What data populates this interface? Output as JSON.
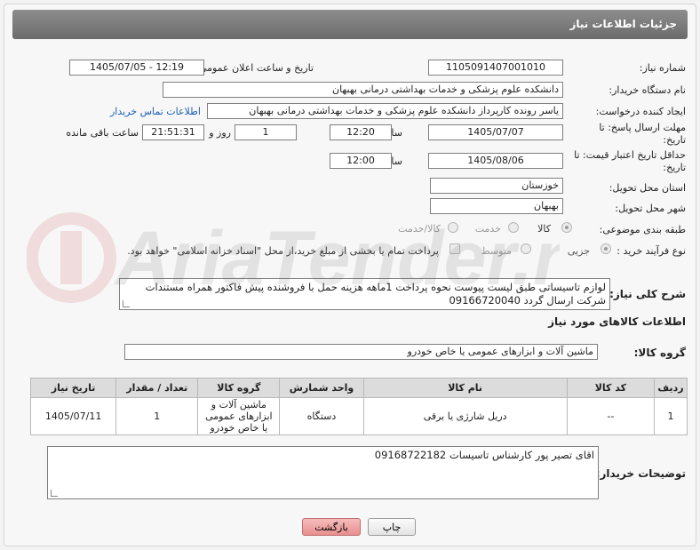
{
  "page": {
    "title": "جزئیات اطلاعات نیاز"
  },
  "form": {
    "need_number": {
      "label": "شماره نیاز:",
      "value": "1105091407001010"
    },
    "announce_datetime": {
      "label": "تاریخ و ساعت اعلان عمومی:",
      "value": "1405/07/05 - 12:19"
    },
    "buyer_org": {
      "label": "نام دستگاه خریدار:",
      "value": "دانشکده علوم پزشکی و خدمات بهداشتی  درمانی بهبهان"
    },
    "requester": {
      "label": "ایجاد کننده درخواست:",
      "value": "یاسر رونده کارپرداز دانشکده علوم پزشکی و خدمات بهداشتی  درمانی بهبهان",
      "contact_link": "اطلاعات تماس خریدار"
    },
    "reply_deadline": {
      "label": "مهلت ارسال پاسخ: تا تاریخ:",
      "date": "1405/07/07",
      "time_label": "ساعت",
      "time": "12:20",
      "days": "1",
      "days_label": "روز و",
      "remaining": "21:51:31",
      "remaining_label": "ساعت باقی مانده"
    },
    "price_validity": {
      "label": "حداقل تاریخ اعتبار قیمت: تا تاریخ:",
      "date": "1405/08/06",
      "time_label": "ساعت",
      "time": "12:00"
    },
    "province": {
      "label": "استان محل تحویل:",
      "value": "خوزستان"
    },
    "city": {
      "label": "شهر محل تحویل:",
      "value": "بهبهان"
    },
    "category": {
      "label": "طبقه بندی موضوعی:",
      "options": [
        "کالا",
        "خدمت",
        "کالا/خدمت"
      ],
      "selected": "کالا"
    },
    "process_type": {
      "label": "نوع فرآیند خرید :",
      "options": [
        "جزیی",
        "متوسط"
      ],
      "selected": "جزیی",
      "payment_note": "پرداخت تمام یا بخشی از مبلغ خرید،از محل \"اسناد خزانه اسلامی\" خواهد بود."
    },
    "general_desc": {
      "label": "شرح کلی نیاز:",
      "value": "لوازم تاسیساتی طبق لیست پیوست نحوه پرداخت 1ماهه هزینه حمل با فروشنده پیش فاکتور همراه مستندات شرکت ارسال گردد 09166720040"
    }
  },
  "goods_section": {
    "title": "اطلاعات کالاهای مورد نیاز",
    "group_label": "گروه کالا:",
    "group_value": "ماشین آلات و ابزارهای عمومی یا خاص خودرو",
    "columns": [
      "ردیف",
      "کد کالا",
      "نام کالا",
      "واحد شمارش",
      "گروه کالا",
      "تعداد / مقدار",
      "تاریخ نیاز"
    ],
    "rows": [
      {
        "row": "1",
        "code": "--",
        "name": "دریل شارژی یا برقی",
        "unit": "دستگاه",
        "group": "ماشین آلات و ابزارهای عمومی یا خاص خودرو",
        "qty": "1",
        "date": "1405/07/11"
      }
    ]
  },
  "buyer_notes": {
    "label": "توضیحات خریدار:",
    "value": "اقای تصیر پور کارشناس تاسیسات 09168722182"
  },
  "buttons": {
    "print": "چاپ",
    "back": "بازگشت"
  },
  "watermark": {
    "text": "AriaTender.net"
  }
}
